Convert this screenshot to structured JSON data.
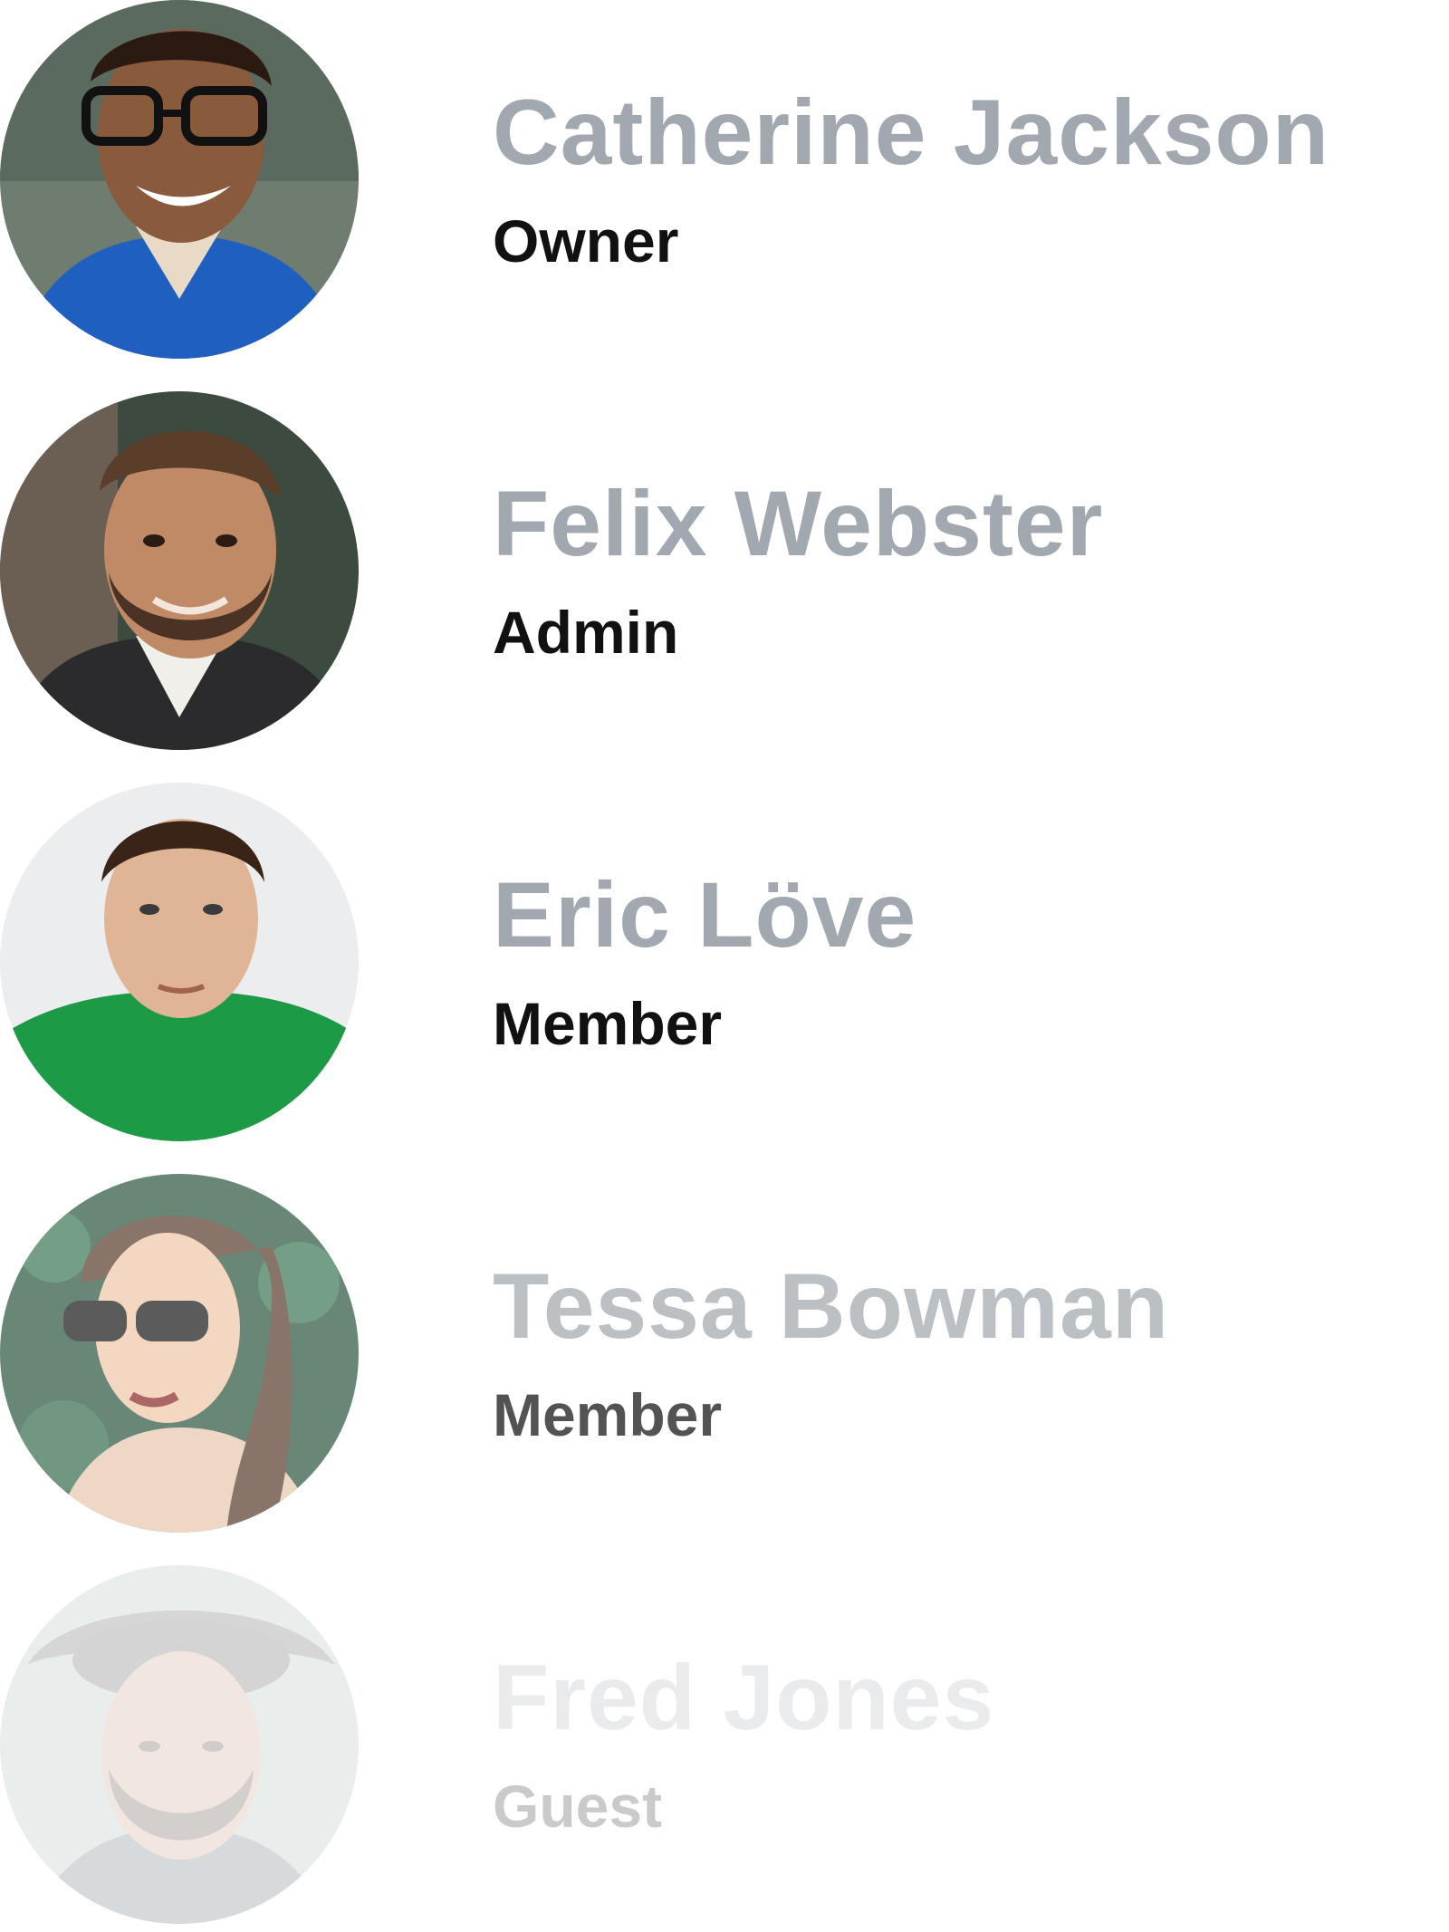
{
  "members": [
    {
      "name": "Catherine Jackson",
      "role": "Owner",
      "avatar_icon": "person-glasses-avatar"
    },
    {
      "name": "Felix Webster",
      "role": "Admin",
      "avatar_icon": "person-beard-avatar"
    },
    {
      "name": "Eric Löve",
      "role": "Member",
      "avatar_icon": "person-green-sweater-avatar"
    },
    {
      "name": "Tessa Bowman",
      "role": "Member",
      "avatar_icon": "person-sunglasses-avatar"
    },
    {
      "name": "Fred Jones",
      "role": "Guest",
      "avatar_icon": "person-hat-avatar"
    }
  ],
  "colors": {
    "name_text": "#a2a8b0",
    "role_text": "#111111",
    "background": "#ffffff"
  }
}
